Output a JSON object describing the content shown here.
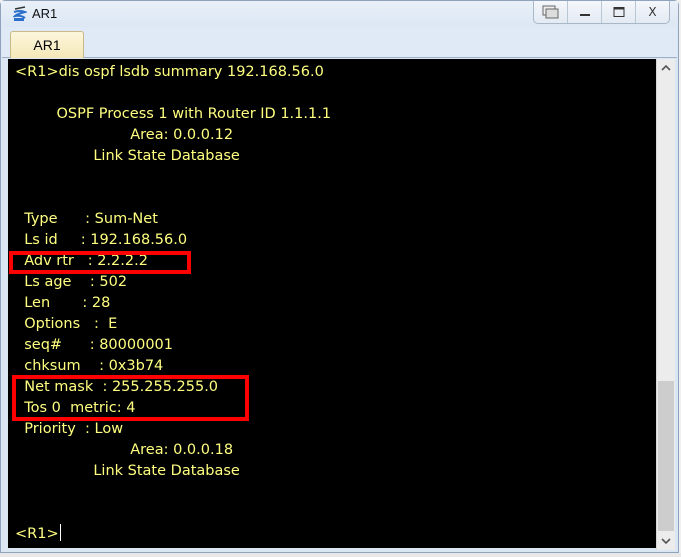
{
  "window": {
    "title": "AR1",
    "controls": {
      "restore_icon": "restore-window-icon",
      "minimize_label": "—",
      "maximize_label": "▭",
      "close_label": "X"
    }
  },
  "tabs": [
    {
      "label": "AR1",
      "active": true
    }
  ],
  "terminal": {
    "text_color": "#ffff80",
    "background": "#000000",
    "lines": [
      "<R1>dis ospf lsdb summary 192.168.56.0",
      "",
      "         OSPF Process 1 with Router ID 1.1.1.1",
      "                         Area: 0.0.0.12",
      "                 Link State Database",
      "",
      "",
      "  Type      : Sum-Net",
      "  Ls id     : 192.168.56.0",
      "  Adv rtr   : 2.2.2.2",
      "  Ls age    : 502",
      "  Len       : 28",
      "  Options   :  E",
      "  seq#      : 80000001",
      "  chksum    : 0x3b74",
      "  Net mask  : 255.255.255.0",
      "  Tos 0  metric: 4",
      "  Priority  : Low",
      "                         Area: 0.0.0.18",
      "                 Link State Database",
      "",
      "",
      "<R1>"
    ],
    "highlight_color": "#ff0000",
    "highlights": [
      {
        "label": "adv-rtr",
        "lines": [
          "Adv rtr   : 2.2.2.2"
        ]
      },
      {
        "label": "net-mask-metric",
        "lines": [
          "Net mask  : 255.255.255.0",
          "Tos 0  metric: 4"
        ]
      }
    ]
  },
  "scrollbar": {
    "up_label": "˄",
    "down_label": "˅",
    "position_fraction": 0.66
  }
}
